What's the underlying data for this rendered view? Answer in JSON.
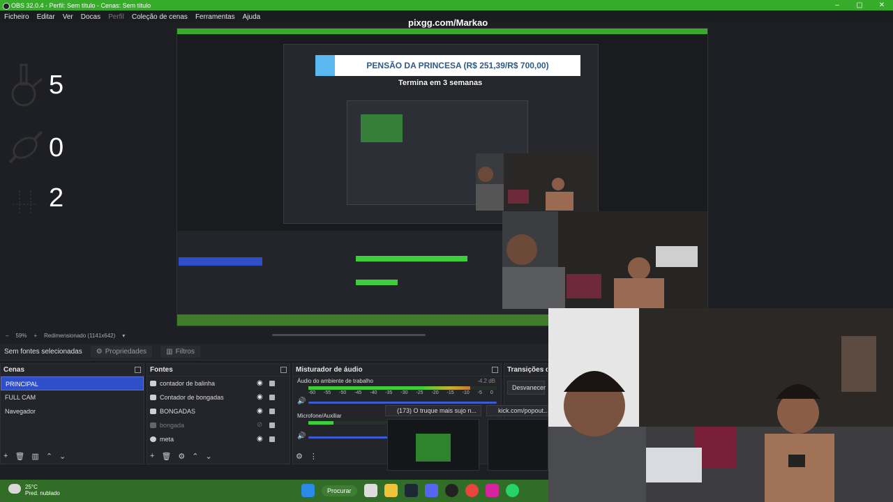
{
  "window": {
    "title": "OBS 32.0.4 - Perfil: Sem título - Cenas: Sem título",
    "controls": [
      "–",
      "▢",
      "✕"
    ]
  },
  "menu": [
    "Ficheiro",
    "Editar",
    "Ver",
    "Docas",
    "Perfil",
    "Coleção de cenas",
    "Ferramentas",
    "Ajuda"
  ],
  "overlay": {
    "url": "pixgg.com/Markao",
    "donation_bar": "PENSÃO DA PRINCESA (R$ 251,39/R$ 700,00)",
    "donation_sub": "Termina em 3 semanas"
  },
  "counters": [
    {
      "icon": "bong-icon",
      "value": "5"
    },
    {
      "icon": "candy-icon",
      "value": "0"
    },
    {
      "icon": "bottle-icon",
      "value": "2"
    }
  ],
  "zoom": {
    "minus": "–",
    "percent": "59%",
    "plus": "+",
    "resize": "Redimensionado (1141x642)"
  },
  "props": {
    "no_source": "Sem fontes selecionadas",
    "properties": "Propriedades",
    "filters": "Filtros"
  },
  "scenes": {
    "title": "Cenas",
    "items": [
      {
        "label": "PRINCIPAL",
        "active": true
      },
      {
        "label": "FULL CAM",
        "active": false
      },
      {
        "label": "Navegador",
        "active": false
      }
    ]
  },
  "sources": {
    "title": "Fontes",
    "items": [
      {
        "label": "contador de balinha",
        "dim": false
      },
      {
        "label": "Contador de bongadas",
        "dim": false
      },
      {
        "label": "BONGADAS",
        "dim": false
      },
      {
        "label": "bongada",
        "dim": true
      },
      {
        "label": "meta",
        "dim": false
      }
    ]
  },
  "mixer": {
    "title": "Misturador de áudio",
    "channels": [
      {
        "name": "Áudio do ambiente de trabalho",
        "db": "-4.2 dB",
        "level": 0.86
      },
      {
        "name": "Microfone/Auxiliar",
        "db": "",
        "level": 0.3
      }
    ],
    "scale": "-60 -55 -50 -45 -40 -35 -30 -25 -20 -15 -10 -5 0"
  },
  "transitions": {
    "title": "Transições de",
    "fade": "Desvanecer"
  },
  "browser_tabs": [
    {
      "label": "(173) O truque mais sujo n..."
    },
    {
      "label": "kick.com/popout..."
    }
  ],
  "taskbar": {
    "temp": "25°C",
    "condition": "Pred. nublado",
    "search": "Procurar"
  },
  "colors": {
    "accent": "#37ab2a",
    "selection": "#2f4fc9",
    "meter_green": "#3dcf3a",
    "meter_yellow": "#c9b02c",
    "meter_red": "#c63131"
  }
}
